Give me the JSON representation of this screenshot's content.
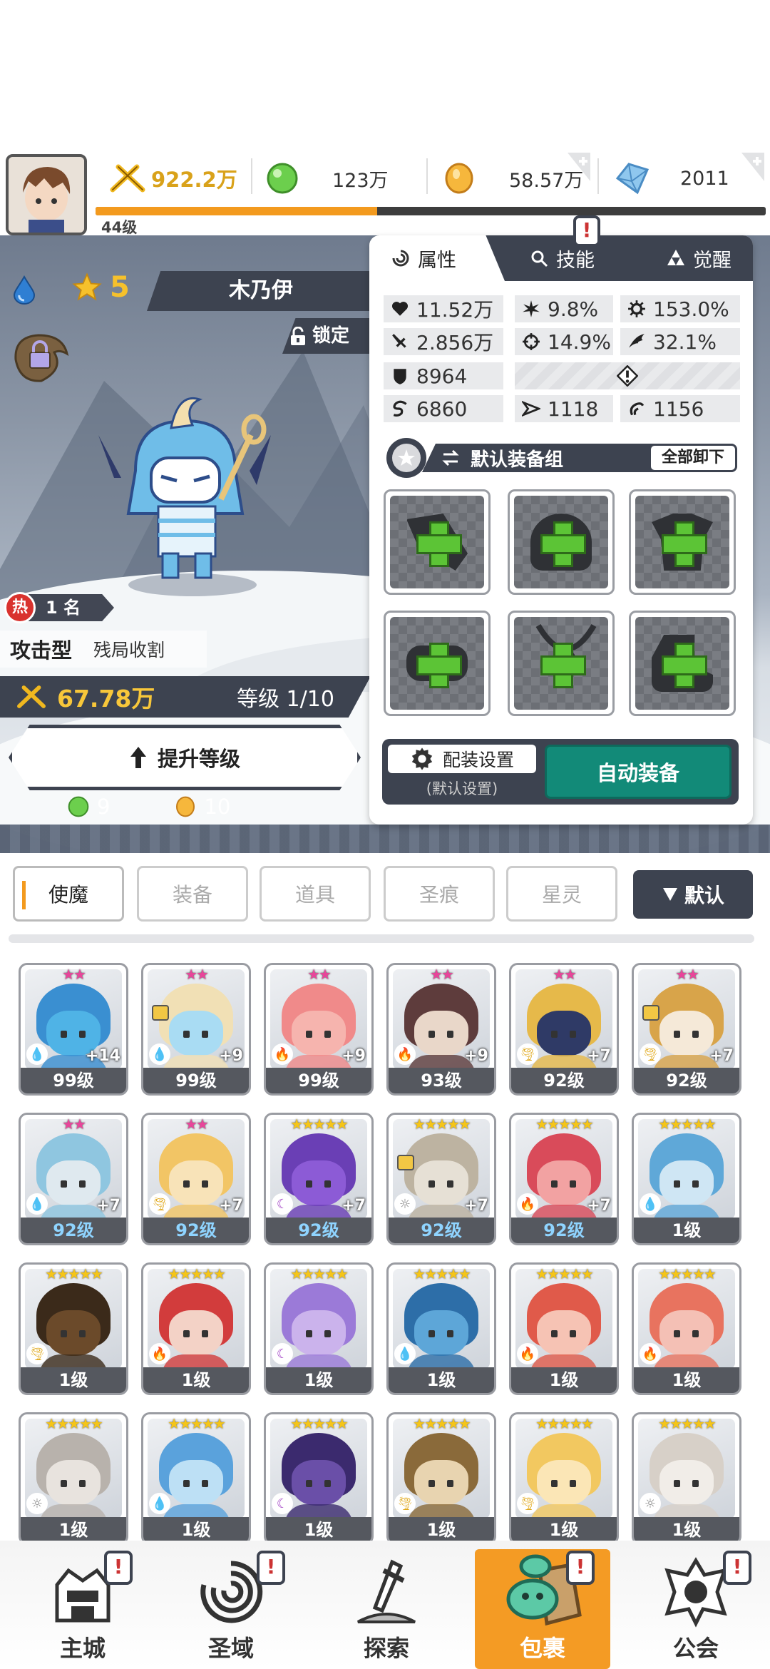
{
  "player": {
    "level": "44级"
  },
  "currencies": {
    "power": "922.2万",
    "green_gems": "123万",
    "gold": "58.57万",
    "diamonds": "2011",
    "xp_progress": 0.42
  },
  "hero": {
    "stars": "5",
    "name": "木乃伊",
    "lock_label": "锁定",
    "rank": "1 名",
    "hot_label": "热",
    "type": "攻击型",
    "role": "残局收割",
    "power": "67.78万",
    "level_text": "等级 1/10",
    "upgrade_label": "提升等级",
    "cost_green": "9",
    "cost_gold": "10"
  },
  "panel": {
    "tabs": [
      "属性",
      "技能",
      "觉醒"
    ],
    "stats": {
      "hp": "11.52万",
      "crit": "9.8%",
      "crit_dmg": "153.0%",
      "atk": "2.856万",
      "acc": "14.9%",
      "speed": "32.1%",
      "def": "8964",
      "res": "6860",
      "pen": "1118",
      "eva": "1156"
    },
    "equip_group": "默认装备组",
    "unequip_all": "全部卸下",
    "config_label": "配装设置",
    "config_sub": "(默认设置)",
    "auto_equip": "自动装备"
  },
  "categories": {
    "tabs": [
      "使魔",
      "装备",
      "道具",
      "圣痕",
      "星灵"
    ],
    "sort": "默认"
  },
  "cards": [
    {
      "lv": "99级",
      "plus": "+14",
      "elem": "water",
      "stars": 2,
      "lock": false,
      "skin": "#4fb3e6",
      "hair": "#3a8fd1"
    },
    {
      "lv": "99级",
      "plus": "+9",
      "elem": "water",
      "stars": 2,
      "lock": true,
      "skin": "#a9dcf3",
      "hair": "#f1e0b5"
    },
    {
      "lv": "99级",
      "plus": "+9",
      "elem": "fire",
      "stars": 2,
      "lock": false,
      "skin": "#f6b4ae",
      "hair": "#f08a8a"
    },
    {
      "lv": "93级",
      "plus": "+9",
      "elem": "fire",
      "stars": 2,
      "lock": false,
      "skin": "#e9d7c9",
      "hair": "#5e3c3c"
    },
    {
      "lv": "92级",
      "plus": "+7",
      "elem": "wind",
      "stars": 2,
      "lock": false,
      "skin": "#2f3a66",
      "hair": "#e6b94a"
    },
    {
      "lv": "92级",
      "plus": "+7",
      "elem": "wind",
      "stars": 2,
      "lock": true,
      "skin": "#f5e9d8",
      "hair": "#d8a44a"
    },
    {
      "lv": "92级",
      "plus": "+7",
      "elem": "water",
      "stars": 2,
      "lock": false,
      "skin": "#dfe9ef",
      "hair": "#8fc6e0",
      "blue": true
    },
    {
      "lv": "92级",
      "plus": "+7",
      "elem": "wind",
      "stars": 2,
      "lock": false,
      "skin": "#f8e3b8",
      "hair": "#f2c565",
      "blue": true
    },
    {
      "lv": "92级",
      "plus": "+7",
      "elem": "dark",
      "stars": 5,
      "lock": false,
      "skin": "#8c5bd6",
      "hair": "#6a3fb5",
      "blue": true
    },
    {
      "lv": "92级",
      "plus": "+7",
      "elem": "light",
      "stars": 5,
      "lock": true,
      "skin": "#e6e0d5",
      "hair": "#bdb3a1",
      "blue": true
    },
    {
      "lv": "92级",
      "plus": "+7",
      "elem": "fire",
      "stars": 5,
      "lock": false,
      "skin": "#f2a2a2",
      "hair": "#d94b5a",
      "blue": true
    },
    {
      "lv": "1级",
      "plus": "",
      "elem": "water",
      "stars": 5,
      "lock": false,
      "skin": "#cfe6f4",
      "hair": "#5fa8d8"
    },
    {
      "lv": "1级",
      "plus": "",
      "elem": "wind",
      "stars": 5,
      "lock": false,
      "skin": "#6b4a2a",
      "hair": "#3b2a1a"
    },
    {
      "lv": "1级",
      "plus": "",
      "elem": "fire",
      "stars": 5,
      "lock": false,
      "skin": "#f3d2c6",
      "hair": "#d23c3c"
    },
    {
      "lv": "1级",
      "plus": "",
      "elem": "dark",
      "stars": 5,
      "lock": false,
      "skin": "#cbb3ec",
      "hair": "#9b7ad8"
    },
    {
      "lv": "1级",
      "plus": "",
      "elem": "water",
      "stars": 5,
      "lock": false,
      "skin": "#5da6d8",
      "hair": "#2d6ea8"
    },
    {
      "lv": "1级",
      "plus": "",
      "elem": "fire",
      "stars": 5,
      "lock": false,
      "skin": "#f6c3b4",
      "hair": "#e05a4a"
    },
    {
      "lv": "1级",
      "plus": "",
      "elem": "fire",
      "stars": 5,
      "lock": false,
      "skin": "#f4c0b5",
      "hair": "#e8735f"
    },
    {
      "lv": "1级",
      "plus": "",
      "elem": "light",
      "stars": 5,
      "lock": false,
      "skin": "#e8e3de",
      "hair": "#b8b2ac"
    },
    {
      "lv": "1级",
      "plus": "",
      "elem": "water",
      "stars": 5,
      "lock": false,
      "skin": "#bde0f5",
      "hair": "#5aa2dc"
    },
    {
      "lv": "1级",
      "plus": "",
      "elem": "dark",
      "stars": 5,
      "lock": false,
      "skin": "#6a4fa8",
      "hair": "#3b2a6e"
    },
    {
      "lv": "1级",
      "plus": "",
      "elem": "wind",
      "stars": 5,
      "lock": false,
      "skin": "#e8d4b0",
      "hair": "#8a6a3a"
    },
    {
      "lv": "1级",
      "plus": "",
      "elem": "wind",
      "stars": 5,
      "lock": false,
      "skin": "#fbe6b6",
      "hair": "#f2c860"
    },
    {
      "lv": "1级",
      "plus": "",
      "elem": "light",
      "stars": 5,
      "lock": false,
      "skin": "#f1ede8",
      "hair": "#d7d0c8"
    }
  ],
  "nav": [
    "主城",
    "圣域",
    "探索",
    "包裹",
    "公会"
  ],
  "alert_glyph": "!"
}
